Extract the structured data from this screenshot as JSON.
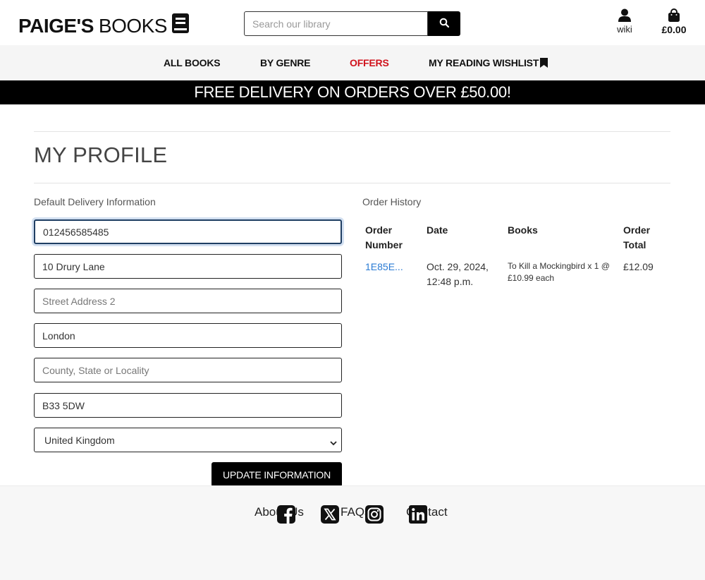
{
  "header": {
    "logo_bold": "PAIGE'S",
    "logo_normal": "BOOKS",
    "search_placeholder": "Search our library",
    "account_label": "wiki",
    "bag_total": "£0.00"
  },
  "nav": {
    "items": [
      {
        "label": "ALL BOOKS"
      },
      {
        "label": "BY GENRE"
      },
      {
        "label": "OFFERS"
      },
      {
        "label": "MY READING WISHLIST"
      }
    ]
  },
  "banner": "FREE DELIVERY ON ORDERS OVER £50.00!",
  "page_title": "MY PROFILE",
  "delivery": {
    "heading": "Default Delivery Information",
    "phone": "012456585485",
    "street1": "10 Drury Lane",
    "street2_placeholder": "Street Address 2",
    "town": "London",
    "county_placeholder": "County, State or Locality",
    "postcode": "B33 5DW",
    "country": "United Kingdom",
    "update_label": "UPDATE INFORMATION"
  },
  "orders": {
    "heading": "Order History",
    "columns": [
      "Order\nNumber",
      "Date",
      "Books",
      "Order\nTotal"
    ],
    "rows": [
      {
        "number": "1E85E...",
        "date": "Oct. 29, 2024, 12:48 p.m.",
        "books": "To Kill a Mockingbird x 1 @ £10.99 each",
        "total": "£12.09"
      }
    ]
  },
  "footer": {
    "links": [
      "About Us",
      "FAQs",
      "Contact"
    ],
    "social_icons": [
      "facebook-icon",
      "x-icon",
      "instagram-icon",
      "linkedin-icon"
    ]
  }
}
